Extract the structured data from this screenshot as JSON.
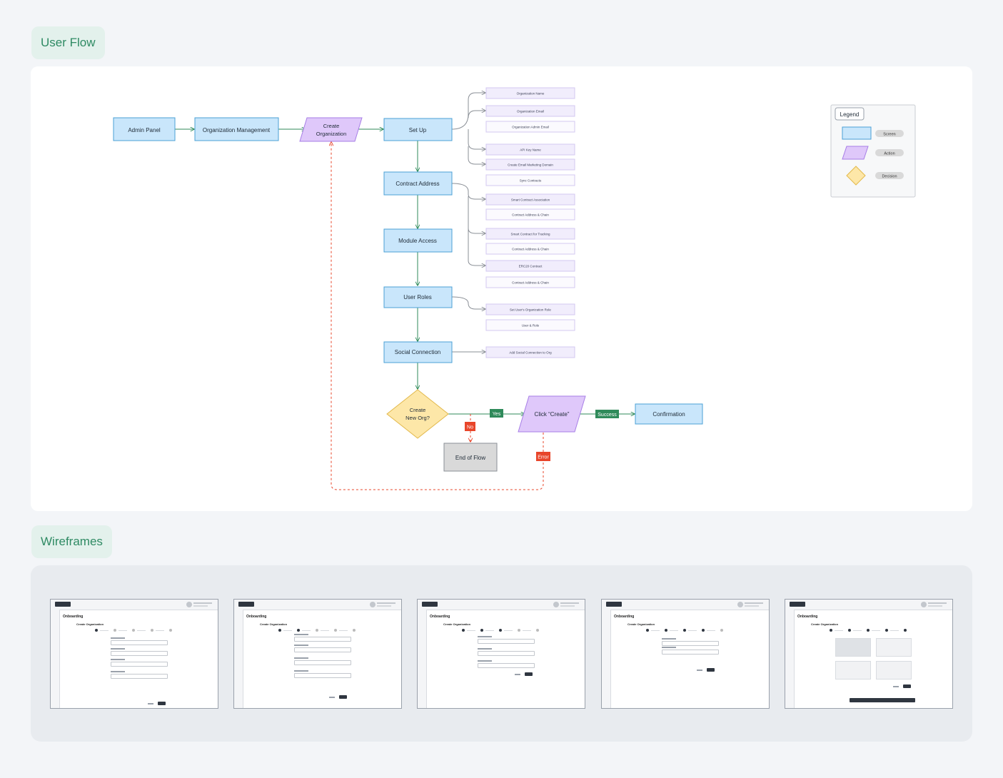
{
  "sections": {
    "user_flow": "User Flow",
    "wireframes": "Wireframes"
  },
  "flow": {
    "screens": {
      "admin_panel": "Admin Panel",
      "org_mgmt": "Organization Management",
      "set_up": "Set Up",
      "contract_address": "Contract Address",
      "module_access": "Module Access",
      "user_roles": "User Roles",
      "social_connection": "Social Connection",
      "confirmation": "Confirmation"
    },
    "actions": {
      "create_org_1": "Create",
      "create_org_2": "Organization",
      "click_create": "Click “Create”"
    },
    "decision": {
      "line1": "Create",
      "line2": "New Org?"
    },
    "end": "End of Flow",
    "labels": {
      "yes": "Yes",
      "no": "No",
      "success": "Success",
      "error": "Error"
    },
    "details": [
      "Organization Name",
      "Organization Email",
      "Organization Admin Email",
      "API Key Name",
      "Create Email Marketing Domain",
      "Sync Contracts",
      "Smart Contract Association",
      "Contract Address & Chain",
      "Smart Contract for Tracking",
      "Contract Address & Chain",
      "ERC20 Contract",
      "Contract Address & Chain",
      "Set User's Organization Role",
      "User & Role",
      "Add Social Connection to Org"
    ]
  },
  "legend": {
    "title": "Legend",
    "screen": "Screen",
    "action": "Action",
    "decision": "Decision"
  },
  "colors": {
    "screen_fill": "#c9e6fb",
    "screen_stroke": "#4ba0d6",
    "action_fill": "#dfc8fa",
    "action_stroke": "#a77ee6",
    "decision_fill": "#fde7a8",
    "decision_stroke": "#e2b84a",
    "end_fill": "#d9d9d9",
    "yes_success": "#2f8a5a",
    "no_error": "#e8452a",
    "detail_fill": "#f1edfc",
    "detail_stroke": "#d3c8f0"
  },
  "wireframes": [
    {
      "logo": "",
      "title": "Onboarding",
      "subtitle": "Create Organization",
      "active_step": 1
    },
    {
      "logo": "",
      "title": "Onboarding",
      "subtitle": "Create Organization",
      "active_step": 2
    },
    {
      "logo": "",
      "title": "Onboarding",
      "subtitle": "Create Organization",
      "active_step": 3
    },
    {
      "logo": "",
      "title": "Onboarding",
      "subtitle": "Create Organization",
      "active_step": 4
    },
    {
      "logo": "",
      "title": "Onboarding",
      "subtitle": "Create Organization",
      "active_step": 5
    }
  ]
}
